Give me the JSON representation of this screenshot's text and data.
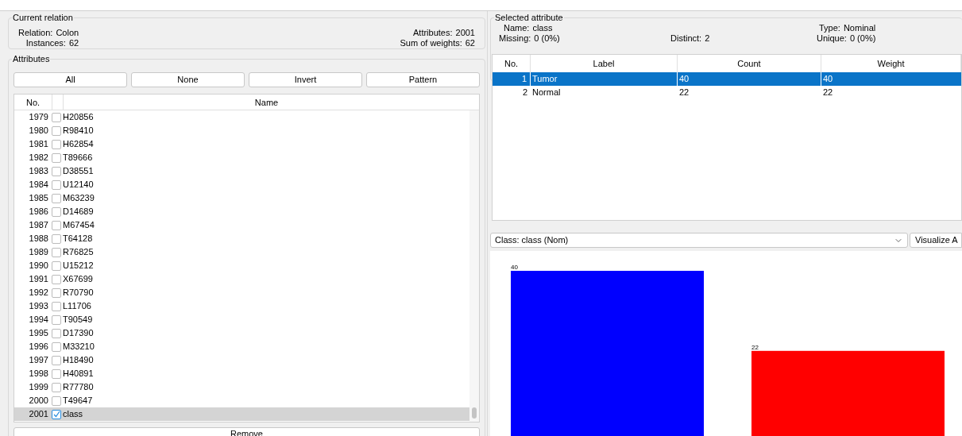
{
  "current_relation": {
    "title": "Current relation",
    "relation": {
      "label": "Relation:",
      "value": "Colon"
    },
    "instances": {
      "label": "Instances:",
      "value": "62"
    },
    "attributes": {
      "label": "Attributes:",
      "value": "2001"
    },
    "sum_of_weights": {
      "label": "Sum of weights:",
      "value": "62"
    }
  },
  "attributes": {
    "title": "Attributes",
    "buttons": [
      "All",
      "None",
      "Invert",
      "Pattern"
    ],
    "columns": [
      "No.",
      "Name"
    ],
    "rows": [
      {
        "no": "1979",
        "name": "H20856",
        "checked": false,
        "selected": false
      },
      {
        "no": "1980",
        "name": "R98410",
        "checked": false,
        "selected": false
      },
      {
        "no": "1981",
        "name": "H62854",
        "checked": false,
        "selected": false
      },
      {
        "no": "1982",
        "name": "T89666",
        "checked": false,
        "selected": false
      },
      {
        "no": "1983",
        "name": "D38551",
        "checked": false,
        "selected": false
      },
      {
        "no": "1984",
        "name": "U12140",
        "checked": false,
        "selected": false
      },
      {
        "no": "1985",
        "name": "M63239",
        "checked": false,
        "selected": false
      },
      {
        "no": "1986",
        "name": "D14689",
        "checked": false,
        "selected": false
      },
      {
        "no": "1987",
        "name": "M67454",
        "checked": false,
        "selected": false
      },
      {
        "no": "1988",
        "name": "T64128",
        "checked": false,
        "selected": false
      },
      {
        "no": "1989",
        "name": "R76825",
        "checked": false,
        "selected": false
      },
      {
        "no": "1990",
        "name": "U15212",
        "checked": false,
        "selected": false
      },
      {
        "no": "1991",
        "name": "X67699",
        "checked": false,
        "selected": false
      },
      {
        "no": "1992",
        "name": "R70790",
        "checked": false,
        "selected": false
      },
      {
        "no": "1993",
        "name": "L11706",
        "checked": false,
        "selected": false
      },
      {
        "no": "1994",
        "name": "T90549",
        "checked": false,
        "selected": false
      },
      {
        "no": "1995",
        "name": "D17390",
        "checked": false,
        "selected": false
      },
      {
        "no": "1996",
        "name": "M33210",
        "checked": false,
        "selected": false
      },
      {
        "no": "1997",
        "name": "H18490",
        "checked": false,
        "selected": false
      },
      {
        "no": "1998",
        "name": "H40891",
        "checked": false,
        "selected": false
      },
      {
        "no": "1999",
        "name": "R77780",
        "checked": false,
        "selected": false
      },
      {
        "no": "2000",
        "name": "T49647",
        "checked": false,
        "selected": false
      },
      {
        "no": "2001",
        "name": "class",
        "checked": true,
        "selected": true
      }
    ],
    "remove_button": "Remove"
  },
  "selected_attribute": {
    "title": "Selected attribute",
    "name": {
      "label": "Name:",
      "value": "class"
    },
    "missing": {
      "label": "Missing:",
      "value": "0 (0%)"
    },
    "distinct": {
      "label": "Distinct:",
      "value": "2"
    },
    "type": {
      "label": "Type:",
      "value": "Nominal"
    },
    "unique": {
      "label": "Unique:",
      "value": "0 (0%)"
    },
    "columns": [
      "No.",
      "Label",
      "Count",
      "Weight"
    ],
    "rows": [
      {
        "cells": [
          "1",
          "Tumor",
          "40",
          "40"
        ],
        "selected": true
      },
      {
        "cells": [
          "2",
          "Normal",
          "22",
          "22"
        ],
        "selected": false
      }
    ]
  },
  "class_select": {
    "value": "Class: class (Nom)"
  },
  "visualize_button": "Visualize A",
  "chart_data": {
    "type": "bar",
    "categories": [
      null,
      null
    ],
    "data_labels": true,
    "series": [
      {
        "colors": [
          "#0000ff",
          "#ff0000"
        ],
        "values": [
          40,
          22
        ]
      }
    ]
  }
}
